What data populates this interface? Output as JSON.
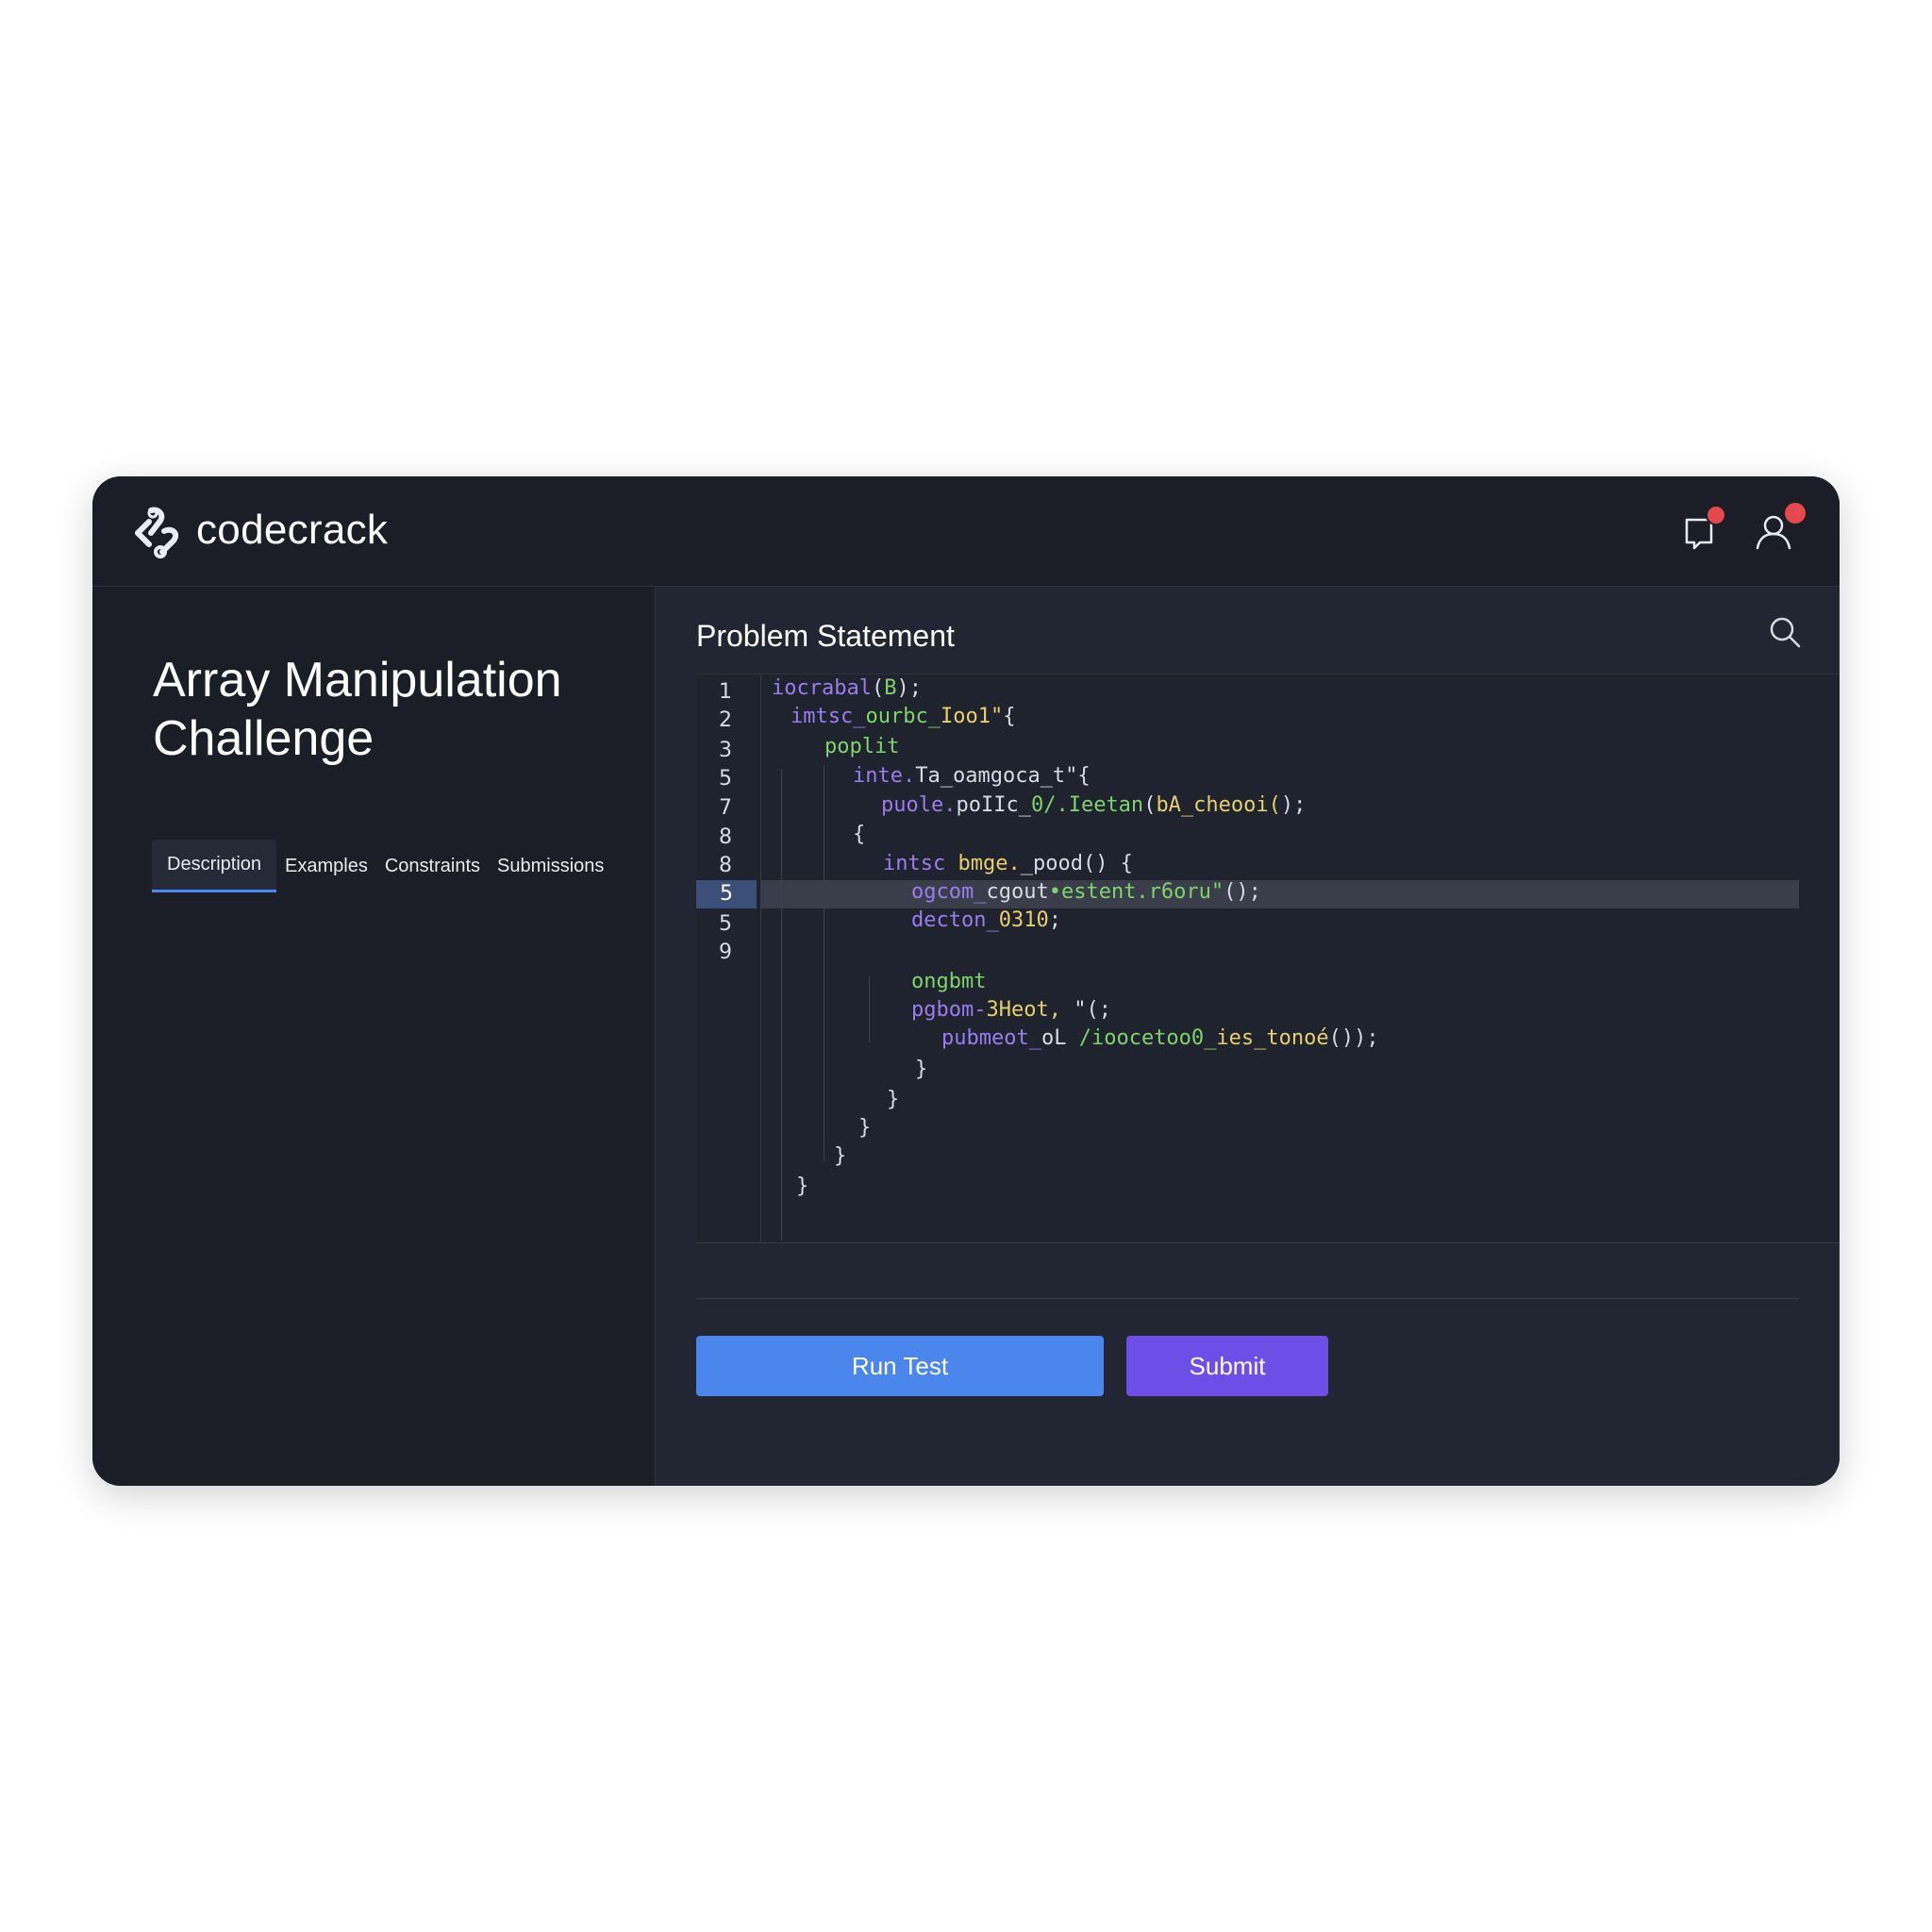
{
  "app": {
    "brand": "codecrack"
  },
  "left": {
    "title": "Array Manipulation Challenge",
    "tabs": [
      "Description",
      "Examples",
      "Constraints",
      "Submissions"
    ],
    "active_tab": "Description"
  },
  "right": {
    "section_title": "Problem Statement"
  },
  "editor": {
    "line_numbers": [
      "1",
      "2",
      "3",
      "5",
      "7",
      "8",
      "8",
      "5",
      "5",
      "9"
    ],
    "active_line_index": 7,
    "code_lines": [
      [
        {
          "t": "iocrabal",
          "c": "#9a7cf0"
        },
        {
          "t": "(",
          "c": "#d7dae2"
        },
        {
          "t": "B",
          "c": "#7fd36b"
        },
        {
          "t": ");",
          "c": "#d7dae2"
        }
      ],
      [
        {
          "t": "imtsc_",
          "c": "#9a7cf0"
        },
        {
          "t": "ourbc_",
          "c": "#7fd36b"
        },
        {
          "t": "Ioo1\"",
          "c": "#e6cf6c"
        },
        {
          "t": "{",
          "c": "#d7dae2"
        }
      ],
      [
        {
          "t": "poplit",
          "c": "#7fd36b"
        }
      ],
      [
        {
          "t": "inte.",
          "c": "#9a7cf0"
        },
        {
          "t": "Ta_oamgoca_t\"",
          "c": "#d7dae2"
        },
        {
          "t": "{",
          "c": "#d7dae2"
        }
      ],
      [
        {
          "t": "puole.",
          "c": "#9a7cf0"
        },
        {
          "t": "poIIc_",
          "c": "#d7dae2"
        },
        {
          "t": "0/.Ieetan",
          "c": "#7fd36b"
        },
        {
          "t": "(",
          "c": "#d7dae2"
        },
        {
          "t": "bA_cheooi(",
          "c": "#e6cf6c"
        },
        {
          "t": ");",
          "c": "#d7dae2"
        }
      ],
      [
        {
          "t": "{",
          "c": "#d7dae2"
        }
      ],
      [
        {
          "t": "intsc ",
          "c": "#9a7cf0"
        },
        {
          "t": "bmge.",
          "c": "#e6cf6c"
        },
        {
          "t": "_pood() {",
          "c": "#d7dae2"
        }
      ],
      [
        {
          "t": "ogcom_",
          "c": "#9a7cf0"
        },
        {
          "t": "cgout",
          "c": "#d7dae2"
        },
        {
          "t": "•estent.r6oru\"",
          "c": "#7fd36b"
        },
        {
          "t": "();",
          "c": "#d7dae2"
        }
      ],
      [
        {
          "t": "decton_",
          "c": "#9a7cf0"
        },
        {
          "t": "0310",
          "c": "#e6cf6c"
        },
        {
          "t": ";",
          "c": "#d7dae2"
        }
      ],
      [
        {
          "t": "ongbmt",
          "c": "#7fd36b"
        }
      ],
      [
        {
          "t": "pgbom-",
          "c": "#9a7cf0"
        },
        {
          "t": "3Heot,",
          "c": "#e6cf6c"
        },
        {
          "t": " \"(;",
          "c": "#d7dae2"
        }
      ],
      [
        {
          "t": "pubmeot_",
          "c": "#9a7cf0"
        },
        {
          "t": "oL ",
          "c": "#d7dae2"
        },
        {
          "t": "/ioocetoo0_",
          "c": "#7fd36b"
        },
        {
          "t": "ies_tonoé",
          "c": "#e6cf6c"
        },
        {
          "t": "());",
          "c": "#d7dae2"
        }
      ],
      [
        {
          "t": "}",
          "c": "#d7dae2"
        }
      ],
      [
        {
          "t": "}",
          "c": "#d7dae2"
        }
      ],
      [
        {
          "t": "}",
          "c": "#d7dae2"
        }
      ],
      [
        {
          "t": "}",
          "c": "#d7dae2"
        }
      ],
      [
        {
          "t": "}",
          "c": "#d7dae2"
        }
      ]
    ]
  },
  "actions": {
    "run_label": "Run Test",
    "submit_label": "Submit"
  },
  "colors": {
    "accent_blue": "#4a86ec",
    "accent_purple": "#6d4fe8",
    "badge_red": "#e5484d"
  }
}
